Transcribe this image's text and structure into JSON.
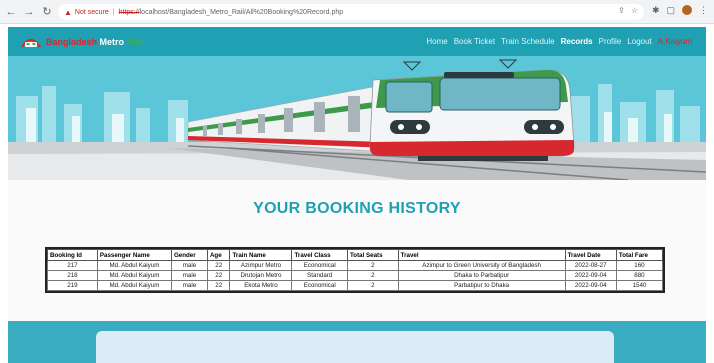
{
  "browser": {
    "not_secure": "Not secure",
    "url_scheme": "https://",
    "url_rest": "localhost/Bangladesh_Metro_Rail/All%20Booking%20Record.php"
  },
  "site": {
    "brand_part1": "Bangladesh",
    "brand_part2": "Metro",
    "brand_part3": "Rail",
    "menu": {
      "home": "Home",
      "book_ticket": "Book Ticket",
      "train_schedule": "Train Schedule",
      "records": "Records",
      "profile": "Profile",
      "logout": "Logout",
      "user": "A.Kaiyum"
    }
  },
  "main": {
    "title": "YOUR BOOKING HISTORY",
    "table": {
      "headers": [
        "Booking Id",
        "Passenger Name",
        "Gender",
        "Age",
        "Train Name",
        "Travel Class",
        "Total Seats",
        "Travel",
        "Travel Date",
        "Total Fare"
      ],
      "rows": [
        [
          "217",
          "Md. Abdul Kaiyum",
          "male",
          "22",
          "Azimpur Metro",
          "Economical",
          "2",
          "Azimpur to Green University of Bangladesh",
          "2022-08-27",
          "160"
        ],
        [
          "218",
          "Md. Abdul Kaiyum",
          "male",
          "22",
          "Drutojan Metro",
          "Standard",
          "2",
          "Dhaka to Parbatipur",
          "2022-09-04",
          "880"
        ],
        [
          "219",
          "Md. Abdul Kaiyum",
          "male",
          "22",
          "Ekota Metro",
          "Economical",
          "2",
          "Parbatipur to Dhaka",
          "2022-09-04",
          "1540"
        ]
      ]
    }
  },
  "colors": {
    "header_bg": "#1fa0b3",
    "title": "#1fa0b3",
    "brand_red": "#d6282e",
    "brand_green": "#37b34a",
    "train_green": "#3c9a4a"
  }
}
